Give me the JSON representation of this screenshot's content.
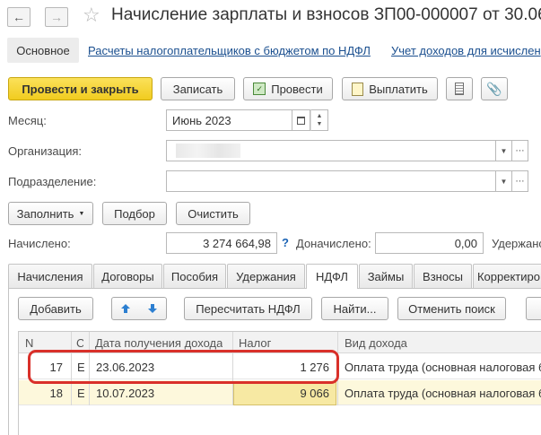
{
  "window": {
    "title": "Начисление зарплаты и взносов ЗП00-000007 от 30.06"
  },
  "nav_tabs": {
    "main": "Основное",
    "link1": "Расчеты налогоплательщиков с бюджетом по НДФЛ",
    "link2": "Учет доходов для исчислен"
  },
  "toolbar": {
    "post_close": "Провести и закрыть",
    "save": "Записать",
    "post": "Провести",
    "pay": "Выплатить"
  },
  "form": {
    "month_label": "Месяц:",
    "month_value": "Июнь 2023",
    "org_label": "Организация:",
    "org_value": "",
    "dept_label": "Подразделение:",
    "dept_value": ""
  },
  "actions": {
    "fill": "Заполнить",
    "pick": "Подбор",
    "clear": "Очистить"
  },
  "totals": {
    "accrued_label": "Начислено:",
    "accrued_value": "3 274 664,98",
    "help": "?",
    "extra_label": "Доначислено:",
    "extra_value": "0,00",
    "withheld_label": "Удержано"
  },
  "tabs": [
    "Начисления",
    "Договоры",
    "Пособия",
    "Удержания",
    "НДФЛ",
    "Займы",
    "Взносы",
    "Корректиро"
  ],
  "table_toolbar": {
    "add": "Добавить",
    "recalc": "Пересчитать НДФЛ",
    "find": "Найти...",
    "cancel_search": "Отменить поиск"
  },
  "table": {
    "headers": [
      "N",
      "С",
      "Дата получения дохода",
      "Налог",
      "Вид дохода"
    ],
    "rows": [
      {
        "n": "17",
        "c": "Е",
        "date": "23.06.2023",
        "tax": "1 276",
        "kind": "Оплата труда (основная налоговая б"
      },
      {
        "n": "18",
        "c": "Е",
        "date": "10.07.2023",
        "tax": "9 066",
        "kind": "Оплата труда (основная налоговая б"
      }
    ]
  },
  "colors": {
    "accent_yellow": "#f7d83a",
    "highlight_red": "#d9302a",
    "selected_row": "#fdf8dc",
    "selected_cell": "#f7e9a3"
  }
}
